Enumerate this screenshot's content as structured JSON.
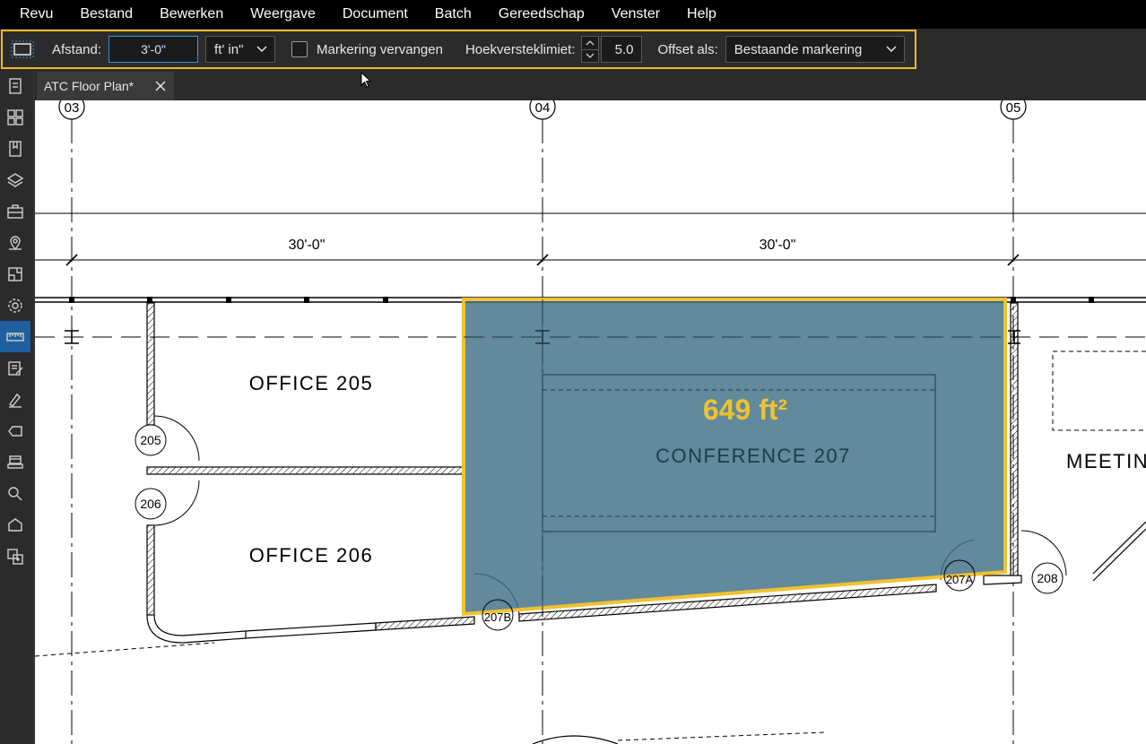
{
  "menu": {
    "items": [
      "Revu",
      "Bestand",
      "Bewerken",
      "Weergave",
      "Document",
      "Batch",
      "Gereedschap",
      "Venster",
      "Help"
    ]
  },
  "toolbar": {
    "tool_icon": "rectangle-dashed-icon",
    "distance_label": "Afstand:",
    "distance_value": "3'-0\"",
    "unit_value": "ft' in\"",
    "replace_label": "Markering vervangen",
    "replace_checked": false,
    "angle_label": "Hoekversteklimiet:",
    "angle_value": "5.0",
    "offset_label": "Offset als:",
    "offset_value": "Bestaande markering",
    "accent_color": "#f0b928"
  },
  "sidebar": {
    "icons": [
      "file-icon",
      "thumbnails-icon",
      "bookmark-icon",
      "layers-icon",
      "toolbox-icon",
      "location-icon",
      "spaces-icon",
      "settings-icon",
      "measure-icon",
      "markups-list-icon",
      "signature-icon",
      "tag-icon",
      "stamp-icon",
      "search-icon",
      "shape-icon",
      "compare-icon"
    ],
    "active": "measure-icon"
  },
  "tabs": [
    {
      "label": "ATC Floor Plan*"
    }
  ],
  "plan": {
    "grid_03": "03",
    "grid_04": "04",
    "grid_05": "05",
    "dim_1": "30'-0\"",
    "dim_2": "30'-0\"",
    "office_205": "OFFICE 205",
    "office_206": "OFFICE 206",
    "conference": "CONFERENCE 207",
    "meeting": "MEETING",
    "area": "649 ft²",
    "door_205": "205",
    "door_206": "206",
    "door_207b": "207B",
    "door_207a": "207A",
    "door_208": "208",
    "area_fill_color": "#3f6f86",
    "area_outline_color": "#f0c230"
  }
}
